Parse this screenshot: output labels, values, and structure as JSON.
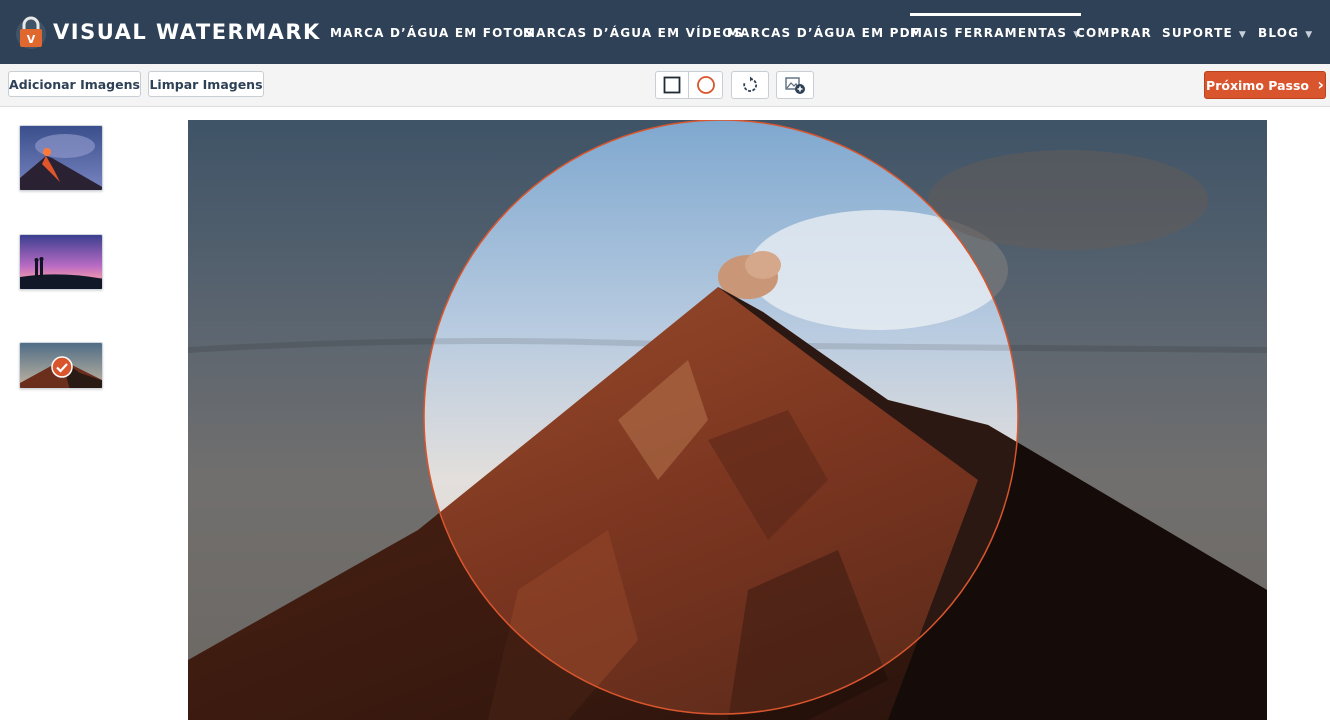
{
  "brand": {
    "name": "VISUAL WATERMARK",
    "logo_letter": "V",
    "logo_icon": "padlock-icon"
  },
  "nav": {
    "items": [
      {
        "label": "MARCA D’ÁGUA EM FOTOS",
        "dropdown": false
      },
      {
        "label": "MARCAS D’ÁGUA EM VÍDEOS",
        "dropdown": false
      },
      {
        "label": "MARCAS D’ÁGUA EM PDF",
        "dropdown": false
      },
      {
        "label": "MAIS FERRAMENTAS",
        "dropdown": true,
        "active": true
      },
      {
        "label": "COMPRAR",
        "dropdown": false
      },
      {
        "label": "SUPORTE",
        "dropdown": true
      },
      {
        "label": "BLOG",
        "dropdown": true
      }
    ],
    "caret": "▼"
  },
  "toolbar": {
    "add_images_label": "Adicionar Imagens",
    "clear_images_label": "Limpar Imagens",
    "tools": [
      "rectangle-crop-icon",
      "circle-crop-icon",
      "rotate-icon",
      "add-image-icon"
    ],
    "next_step_label": "Próximo Passo",
    "next_step_arrow": "›"
  },
  "thumbnails": [
    {
      "name": "volcano-eruption-thumb",
      "selected": false
    },
    {
      "name": "couple-sunset-thumb",
      "selected": false
    },
    {
      "name": "volcano-peak-thumb",
      "selected": true
    }
  ],
  "editor": {
    "crop_shape": "circle",
    "image": "volcano-peak"
  },
  "colors": {
    "nav_bg": "#2f4156",
    "accent": "#d8552d",
    "crop_outline": "#d8552d",
    "toolbar_bg": "#f4f4f4"
  }
}
